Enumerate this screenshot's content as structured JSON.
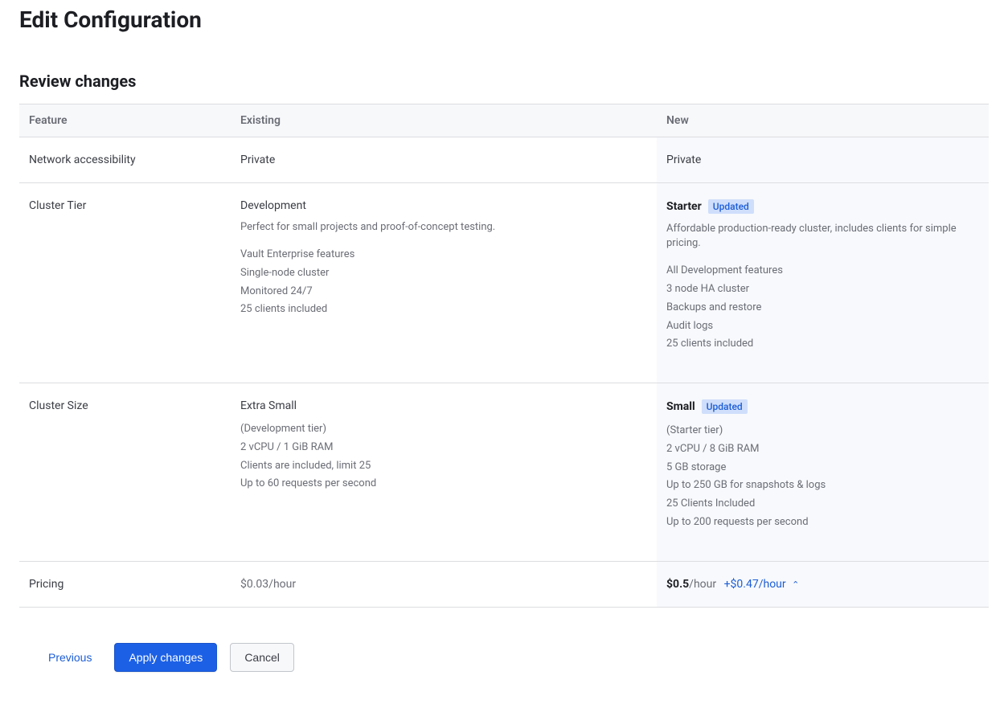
{
  "page": {
    "title": "Edit Configuration",
    "section_title": "Review changes"
  },
  "headers": {
    "feature": "Feature",
    "existing": "Existing",
    "new": "New"
  },
  "rows": {
    "network": {
      "label": "Network accessibility",
      "existing": "Private",
      "new": "Private"
    },
    "tier": {
      "label": "Cluster Tier",
      "existing": {
        "name": "Development",
        "desc": "Perfect for small projects and proof-of-concept testing.",
        "features": [
          "Vault Enterprise features",
          "Single-node cluster",
          "Monitored 24/7",
          "25 clients included"
        ]
      },
      "new": {
        "name": "Starter",
        "badge": "Updated",
        "desc": "Affordable production-ready cluster, includes clients for simple pricing.",
        "features": [
          "All Development features",
          "3 node HA cluster",
          "Backups and restore",
          "Audit logs",
          "25 clients included"
        ]
      }
    },
    "size": {
      "label": "Cluster Size",
      "existing": {
        "name": "Extra Small",
        "features": [
          "(Development tier)",
          "2 vCPU / 1 GiB RAM",
          "Clients are included, limit 25",
          "Up to 60 requests per second"
        ]
      },
      "new": {
        "name": "Small",
        "badge": "Updated",
        "features": [
          "(Starter tier)",
          "2 vCPU / 8 GiB RAM",
          "5 GB storage",
          "Up to 250 GB for snapshots & logs",
          "25 Clients Included",
          "Up to 200 requests per second"
        ]
      }
    },
    "pricing": {
      "label": "Pricing",
      "existing": "$0.03/hour",
      "new": {
        "amount": "$0.5",
        "unit": "/hour",
        "delta": "+$0.47/hour"
      }
    }
  },
  "actions": {
    "previous": "Previous",
    "apply": "Apply changes",
    "cancel": "Cancel"
  }
}
